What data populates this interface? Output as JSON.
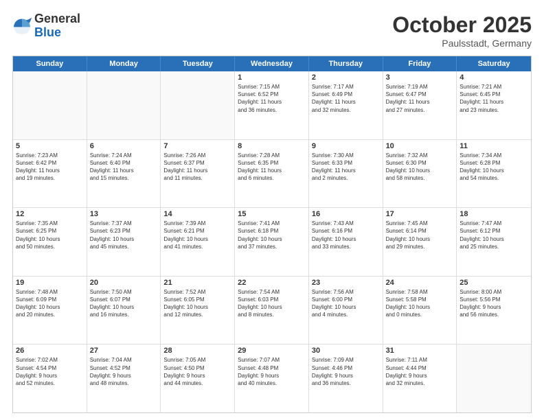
{
  "header": {
    "logo_general": "General",
    "logo_blue": "Blue",
    "title": "October 2025",
    "location": "Paulsstadt, Germany"
  },
  "weekdays": [
    "Sunday",
    "Monday",
    "Tuesday",
    "Wednesday",
    "Thursday",
    "Friday",
    "Saturday"
  ],
  "rows": [
    [
      {
        "day": "",
        "info": ""
      },
      {
        "day": "",
        "info": ""
      },
      {
        "day": "",
        "info": ""
      },
      {
        "day": "1",
        "info": "Sunrise: 7:15 AM\nSunset: 6:52 PM\nDaylight: 11 hours\nand 36 minutes."
      },
      {
        "day": "2",
        "info": "Sunrise: 7:17 AM\nSunset: 6:49 PM\nDaylight: 11 hours\nand 32 minutes."
      },
      {
        "day": "3",
        "info": "Sunrise: 7:19 AM\nSunset: 6:47 PM\nDaylight: 11 hours\nand 27 minutes."
      },
      {
        "day": "4",
        "info": "Sunrise: 7:21 AM\nSunset: 6:45 PM\nDaylight: 11 hours\nand 23 minutes."
      }
    ],
    [
      {
        "day": "5",
        "info": "Sunrise: 7:23 AM\nSunset: 6:42 PM\nDaylight: 11 hours\nand 19 minutes."
      },
      {
        "day": "6",
        "info": "Sunrise: 7:24 AM\nSunset: 6:40 PM\nDaylight: 11 hours\nand 15 minutes."
      },
      {
        "day": "7",
        "info": "Sunrise: 7:26 AM\nSunset: 6:37 PM\nDaylight: 11 hours\nand 11 minutes."
      },
      {
        "day": "8",
        "info": "Sunrise: 7:28 AM\nSunset: 6:35 PM\nDaylight: 11 hours\nand 6 minutes."
      },
      {
        "day": "9",
        "info": "Sunrise: 7:30 AM\nSunset: 6:33 PM\nDaylight: 11 hours\nand 2 minutes."
      },
      {
        "day": "10",
        "info": "Sunrise: 7:32 AM\nSunset: 6:30 PM\nDaylight: 10 hours\nand 58 minutes."
      },
      {
        "day": "11",
        "info": "Sunrise: 7:34 AM\nSunset: 6:28 PM\nDaylight: 10 hours\nand 54 minutes."
      }
    ],
    [
      {
        "day": "12",
        "info": "Sunrise: 7:35 AM\nSunset: 6:25 PM\nDaylight: 10 hours\nand 50 minutes."
      },
      {
        "day": "13",
        "info": "Sunrise: 7:37 AM\nSunset: 6:23 PM\nDaylight: 10 hours\nand 45 minutes."
      },
      {
        "day": "14",
        "info": "Sunrise: 7:39 AM\nSunset: 6:21 PM\nDaylight: 10 hours\nand 41 minutes."
      },
      {
        "day": "15",
        "info": "Sunrise: 7:41 AM\nSunset: 6:18 PM\nDaylight: 10 hours\nand 37 minutes."
      },
      {
        "day": "16",
        "info": "Sunrise: 7:43 AM\nSunset: 6:16 PM\nDaylight: 10 hours\nand 33 minutes."
      },
      {
        "day": "17",
        "info": "Sunrise: 7:45 AM\nSunset: 6:14 PM\nDaylight: 10 hours\nand 29 minutes."
      },
      {
        "day": "18",
        "info": "Sunrise: 7:47 AM\nSunset: 6:12 PM\nDaylight: 10 hours\nand 25 minutes."
      }
    ],
    [
      {
        "day": "19",
        "info": "Sunrise: 7:48 AM\nSunset: 6:09 PM\nDaylight: 10 hours\nand 20 minutes."
      },
      {
        "day": "20",
        "info": "Sunrise: 7:50 AM\nSunset: 6:07 PM\nDaylight: 10 hours\nand 16 minutes."
      },
      {
        "day": "21",
        "info": "Sunrise: 7:52 AM\nSunset: 6:05 PM\nDaylight: 10 hours\nand 12 minutes."
      },
      {
        "day": "22",
        "info": "Sunrise: 7:54 AM\nSunset: 6:03 PM\nDaylight: 10 hours\nand 8 minutes."
      },
      {
        "day": "23",
        "info": "Sunrise: 7:56 AM\nSunset: 6:00 PM\nDaylight: 10 hours\nand 4 minutes."
      },
      {
        "day": "24",
        "info": "Sunrise: 7:58 AM\nSunset: 5:58 PM\nDaylight: 10 hours\nand 0 minutes."
      },
      {
        "day": "25",
        "info": "Sunrise: 8:00 AM\nSunset: 5:56 PM\nDaylight: 9 hours\nand 56 minutes."
      }
    ],
    [
      {
        "day": "26",
        "info": "Sunrise: 7:02 AM\nSunset: 4:54 PM\nDaylight: 9 hours\nand 52 minutes."
      },
      {
        "day": "27",
        "info": "Sunrise: 7:04 AM\nSunset: 4:52 PM\nDaylight: 9 hours\nand 48 minutes."
      },
      {
        "day": "28",
        "info": "Sunrise: 7:05 AM\nSunset: 4:50 PM\nDaylight: 9 hours\nand 44 minutes."
      },
      {
        "day": "29",
        "info": "Sunrise: 7:07 AM\nSunset: 4:48 PM\nDaylight: 9 hours\nand 40 minutes."
      },
      {
        "day": "30",
        "info": "Sunrise: 7:09 AM\nSunset: 4:46 PM\nDaylight: 9 hours\nand 36 minutes."
      },
      {
        "day": "31",
        "info": "Sunrise: 7:11 AM\nSunset: 4:44 PM\nDaylight: 9 hours\nand 32 minutes."
      },
      {
        "day": "",
        "info": ""
      }
    ]
  ]
}
